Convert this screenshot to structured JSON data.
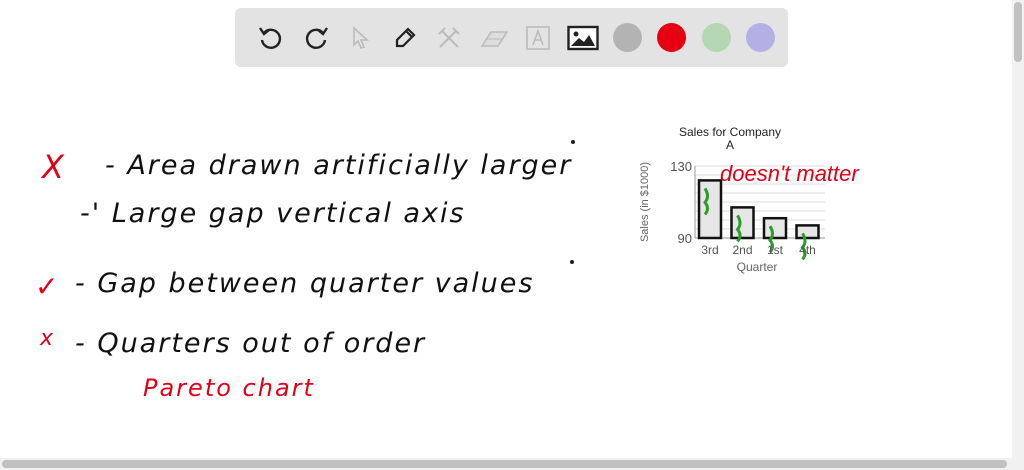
{
  "toolbar": {
    "tools": [
      "undo-icon",
      "redo-icon",
      "select-icon",
      "pen-icon",
      "tools-icon",
      "eraser-icon",
      "text-icon",
      "image-icon"
    ],
    "colors": [
      "#b3b3b3",
      "#e60012",
      "#b5d6b2",
      "#b4b0e6"
    ]
  },
  "notes": {
    "line1_mark": "X",
    "line1": "- Area drawn artificially larger",
    "line2": "-' Large gap vertical axis",
    "line3_mark": "✓",
    "line3": "- Gap between quarter values",
    "line4_mark": "x",
    "line4": "- Quarters out of order",
    "pareto": "Pareto chart",
    "annotation": "doesn't matter"
  },
  "chart_data": {
    "type": "bar",
    "title": "Sales for Company A",
    "title_line1": "Sales for Company",
    "title_line2": "A",
    "xlabel": "Quarter",
    "ylabel": "Sales (in $1000)",
    "categories": [
      "3rd",
      "2nd",
      "1st",
      "4th"
    ],
    "values": [
      122,
      107,
      101,
      97
    ],
    "ylim": [
      90,
      130
    ],
    "yticks": [
      "90",
      "130"
    ],
    "grid": true
  }
}
